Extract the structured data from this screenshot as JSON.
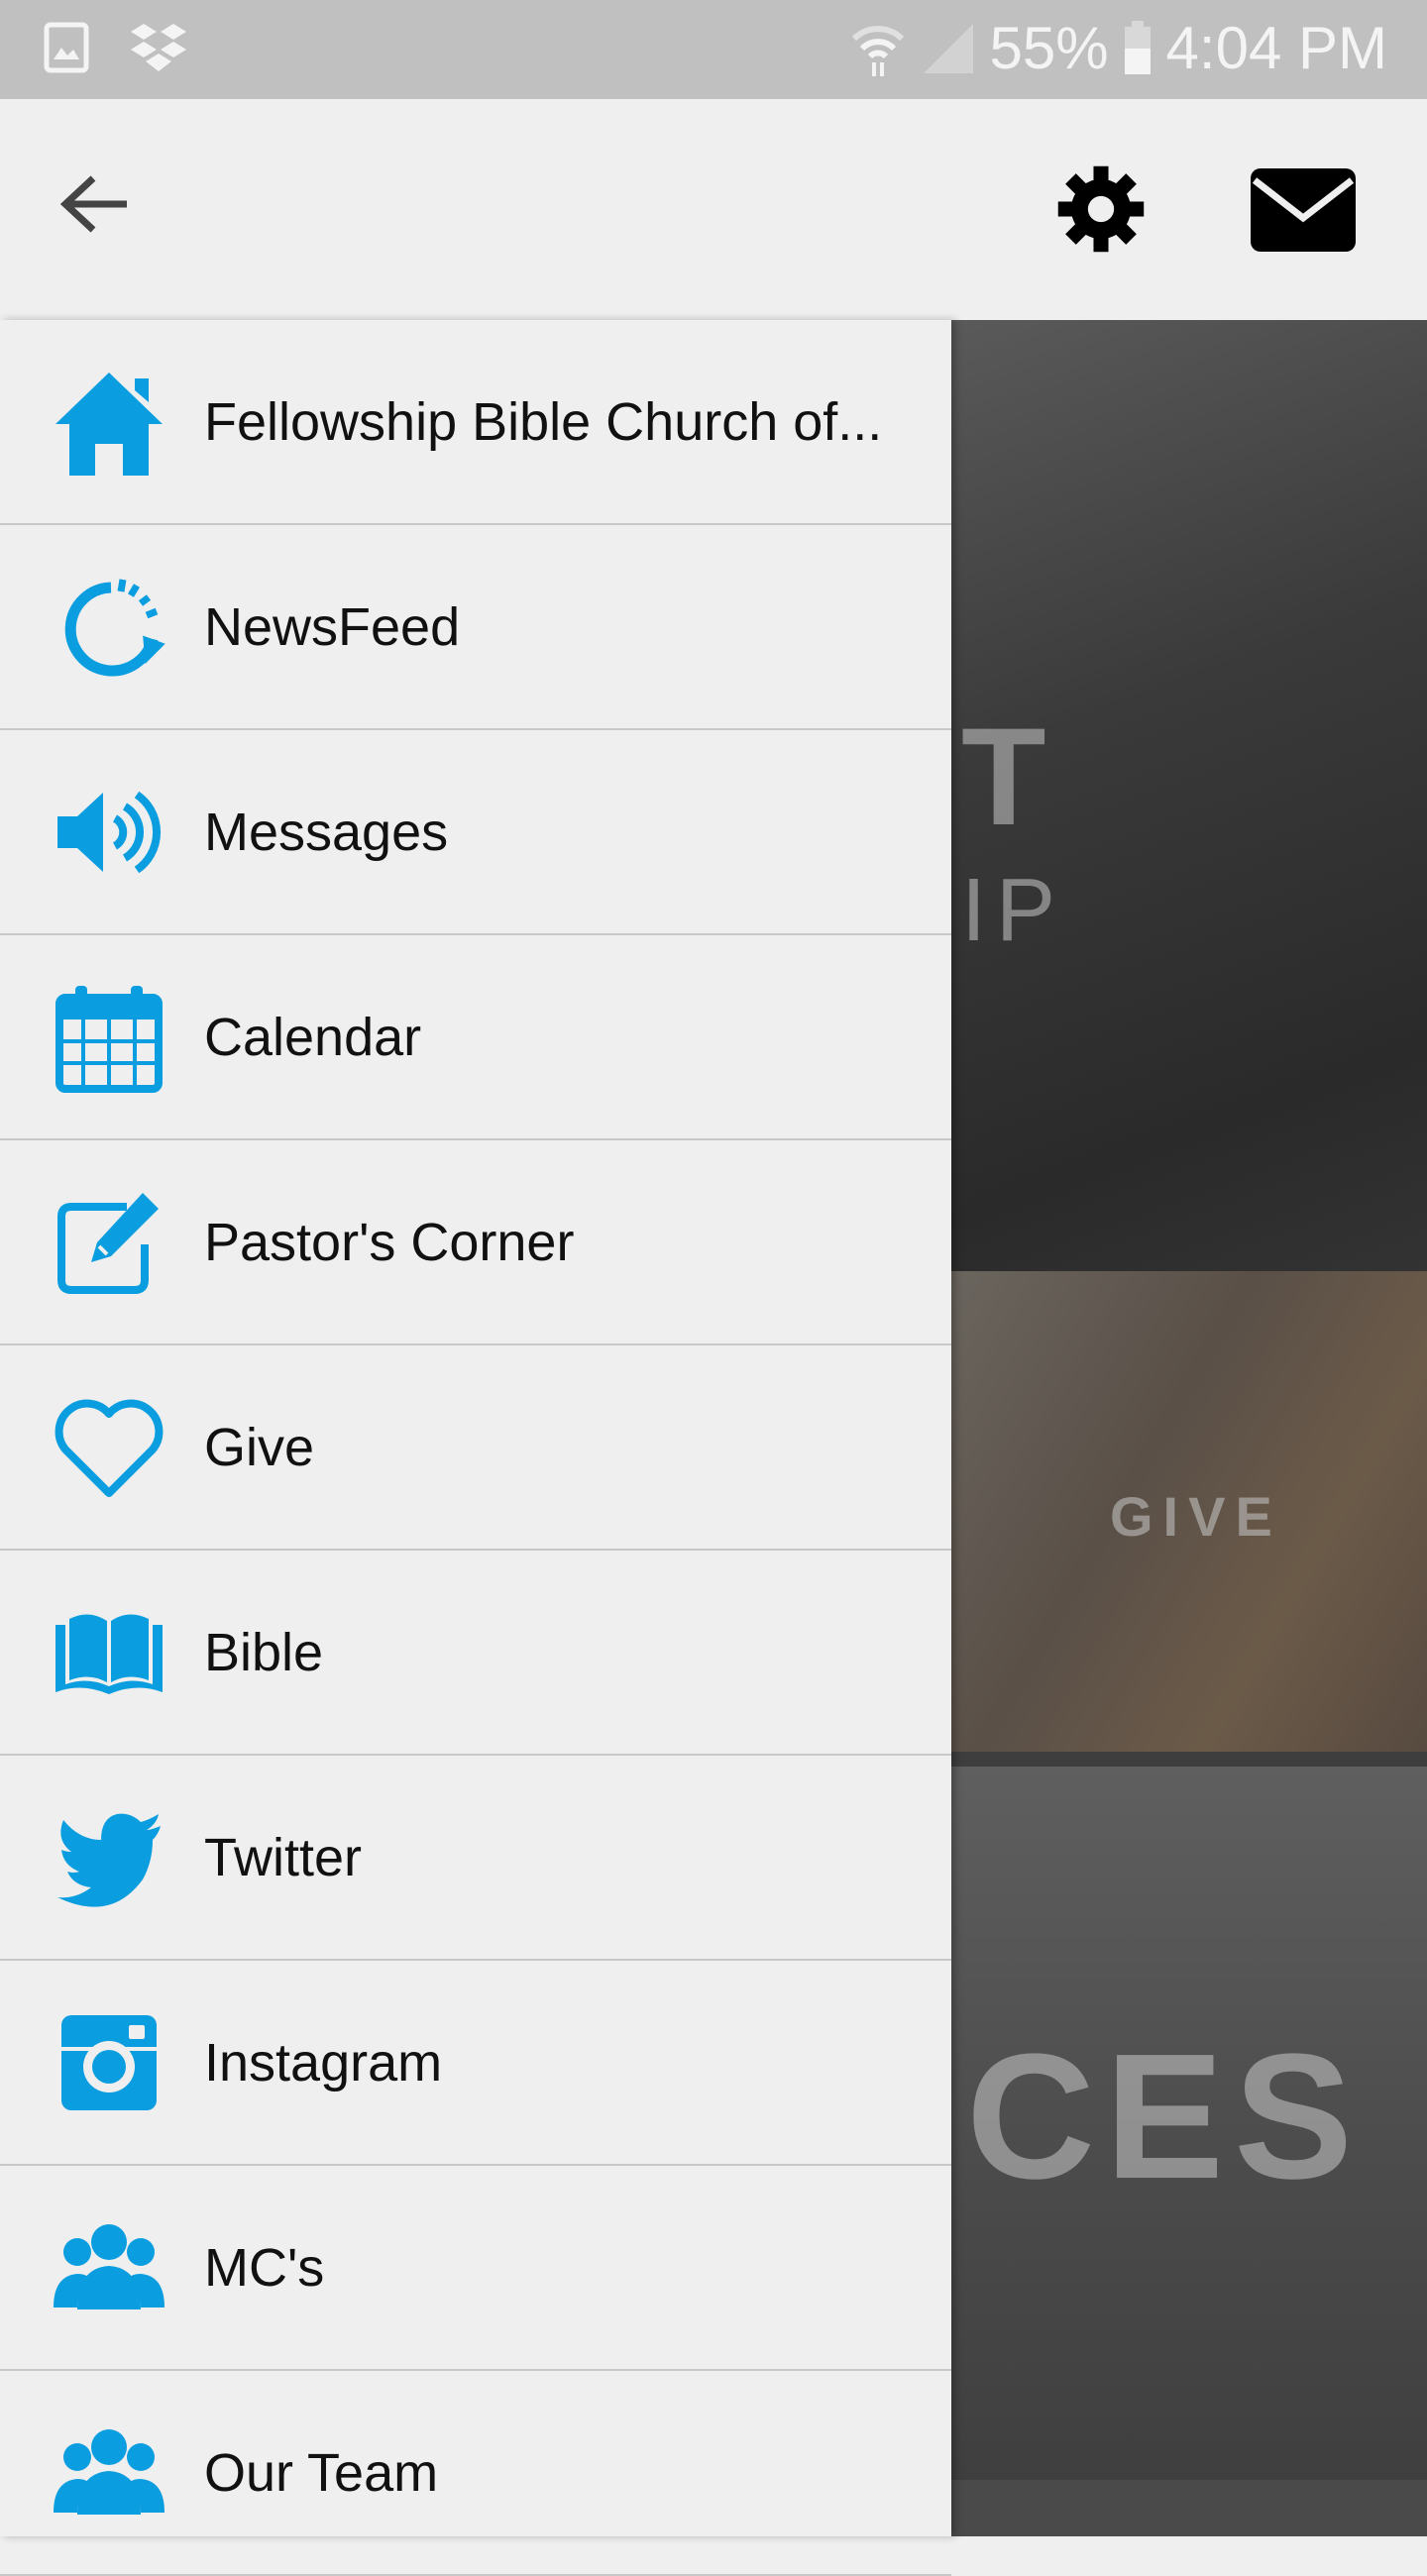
{
  "status_bar": {
    "battery": "55%",
    "time": "4:04 PM",
    "icons": [
      "gallery-icon",
      "dropbox-icon",
      "wifi-icon",
      "signal-icon",
      "battery-icon"
    ]
  },
  "header": {
    "icons": [
      "back-arrow-icon",
      "gear-icon",
      "mail-icon"
    ]
  },
  "accent_color": "#0a9ee0",
  "menu": [
    {
      "label": "Fellowship Bible Church of...",
      "icon": "home-icon"
    },
    {
      "label": "NewsFeed",
      "icon": "refresh-icon"
    },
    {
      "label": "Messages",
      "icon": "speaker-icon"
    },
    {
      "label": "Calendar",
      "icon": "calendar-icon"
    },
    {
      "label": "Pastor's Corner",
      "icon": "edit-icon"
    },
    {
      "label": "Give",
      "icon": "heart-icon"
    },
    {
      "label": "Bible",
      "icon": "book-icon"
    },
    {
      "label": "Twitter",
      "icon": "twitter-icon"
    },
    {
      "label": "Instagram",
      "icon": "instagram-icon"
    },
    {
      "label": "MC's",
      "icon": "group-icon"
    },
    {
      "label": "Our Team",
      "icon": "group-icon"
    }
  ],
  "background_tiles": {
    "tile1": "T",
    "tile1_sub": "IP",
    "tile2": "GIVE",
    "tile3": "CES"
  }
}
